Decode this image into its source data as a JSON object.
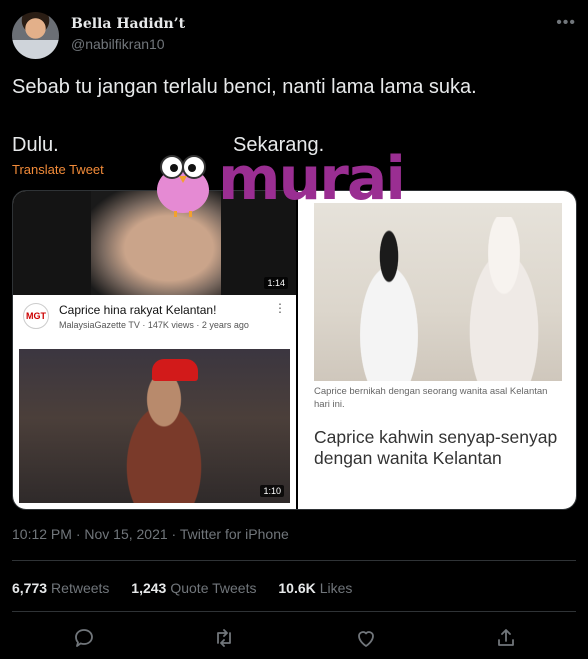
{
  "author": {
    "name": "Bella Hadidn’t",
    "handle": "@nabilfikran10"
  },
  "tweet": {
    "text": "Sebab tu jangan terlalu benci, nanti lama lama suka.",
    "label_left": "Dulu.",
    "label_right": "Sekarang.",
    "translate": "Translate Tweet"
  },
  "watermark": "murai",
  "media": {
    "video_top_duration": "1:14",
    "channel_logo": "MGT",
    "video_title": "Caprice hina rakyat Kelantan!",
    "video_meta": "MalaysiaGazette TV · 147K views · 2 years ago",
    "video_bottom_duration": "1:10",
    "article_caption": "Caprice bernikah dengan seorang wanita asal Kelantan hari ini.",
    "article_headline": "Caprice kahwin senyap-senyap dengan wanita Kelantan"
  },
  "meta": {
    "timestamp": "10:12 PM · Nov 15, 2021 · Twitter for iPhone"
  },
  "stats": {
    "retweets_count": "6,773",
    "retweets_label": "Retweets",
    "quotes_count": "1,243",
    "quotes_label": "Quote Tweets",
    "likes_count": "10.6K",
    "likes_label": "Likes"
  },
  "actions": [
    "reply-icon",
    "retweet-icon",
    "like-icon",
    "share-icon"
  ],
  "colors": {
    "accent": "#f28b39",
    "muted": "#71767b",
    "text": "#e7e9ea",
    "murai": "#9a2e92"
  }
}
